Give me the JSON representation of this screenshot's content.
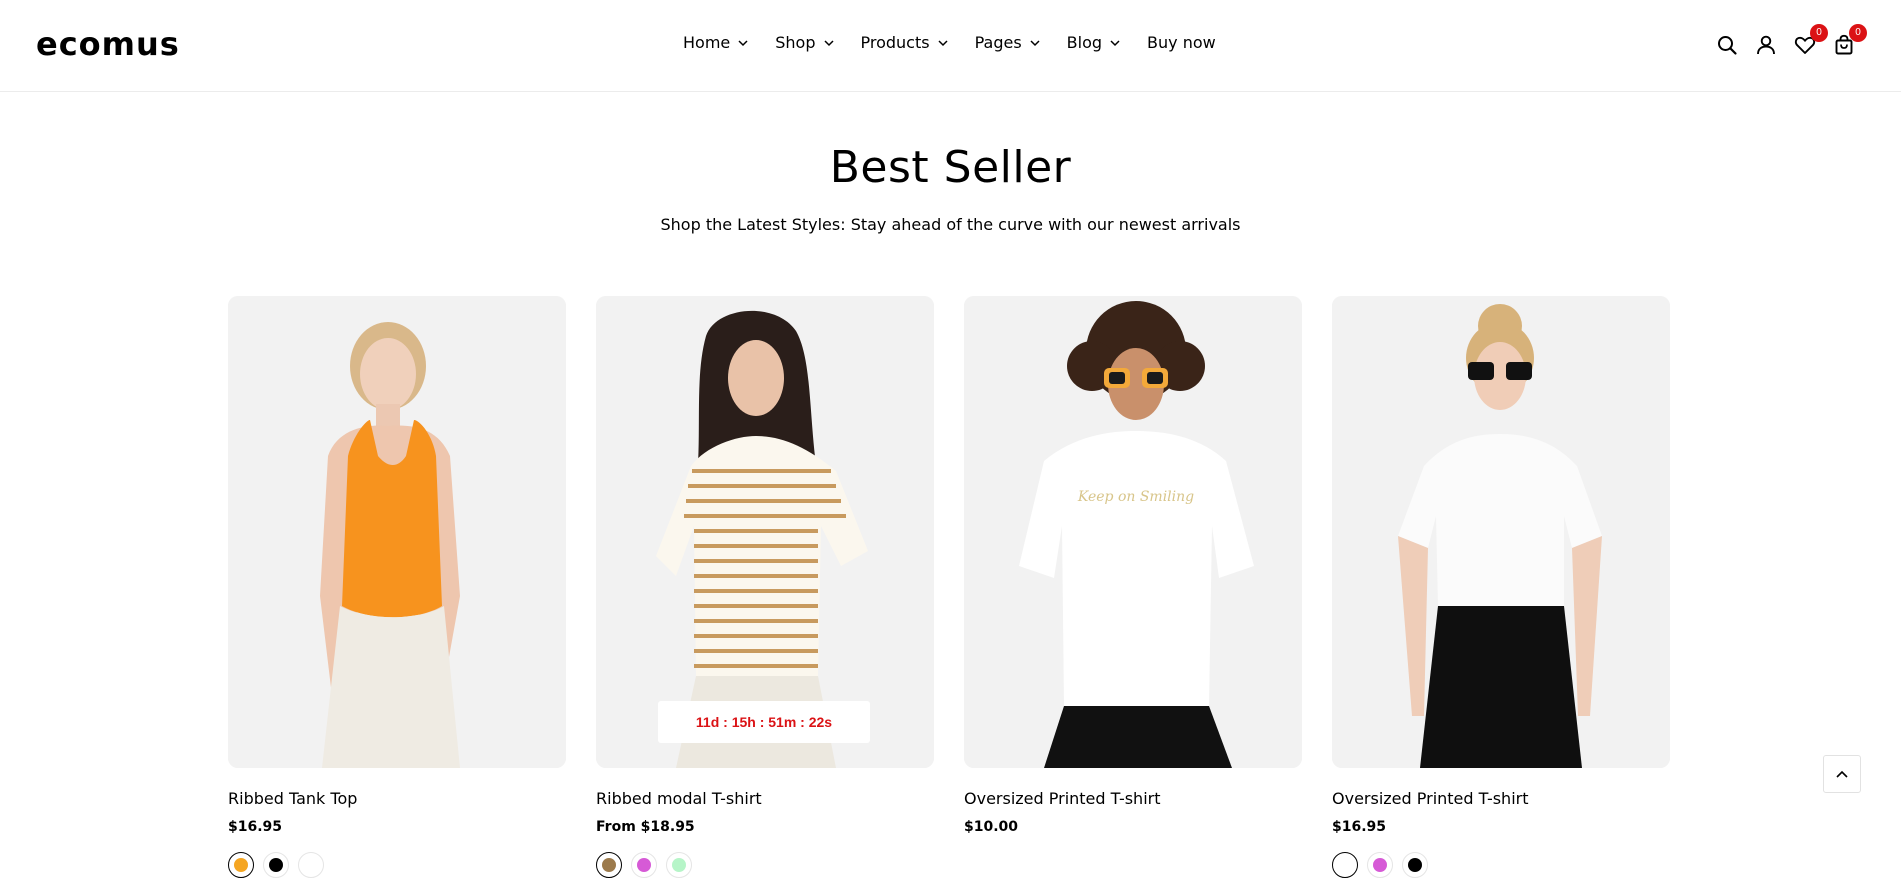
{
  "header": {
    "logo": "ecomus",
    "nav": [
      {
        "label": "Home",
        "has_dropdown": true
      },
      {
        "label": "Shop",
        "has_dropdown": true
      },
      {
        "label": "Products",
        "has_dropdown": true
      },
      {
        "label": "Pages",
        "has_dropdown": true
      },
      {
        "label": "Blog",
        "has_dropdown": true
      },
      {
        "label": "Buy now",
        "has_dropdown": false
      }
    ],
    "icons": {
      "search": "search-icon",
      "account": "user-icon",
      "wishlist": "heart-icon",
      "cart": "bag-icon"
    },
    "wishlist_count": "0",
    "cart_count": "0"
  },
  "section": {
    "title": "Best Seller",
    "subtitle": "Shop the Latest Styles: Stay ahead of the curve with our newest arrivals"
  },
  "products": [
    {
      "name": "Ribbed Tank Top",
      "price": "$16.95",
      "swatches": [
        "#f5a623",
        "#000000",
        "#ffffff"
      ],
      "active_swatch": 0,
      "countdown": ""
    },
    {
      "name": "Ribbed modal T-shirt",
      "price": "From $18.95",
      "swatches": [
        "#9c7a4b",
        "#d65ad6",
        "#b6f5c8"
      ],
      "active_swatch": 0,
      "countdown": "11d : 15h : 51m : 22s"
    },
    {
      "name": "Oversized Printed T-shirt",
      "price": "$10.00",
      "swatches": [],
      "active_swatch": -1,
      "countdown": ""
    },
    {
      "name": "Oversized Printed T-shirt",
      "price": "$16.95",
      "swatches": [
        "#ffffff",
        "#d65ad6",
        "#000000"
      ],
      "active_swatch": 0,
      "countdown": ""
    }
  ],
  "colors": {
    "accent": "#db1215",
    "card_bg": "#f2f2f2"
  },
  "back_to_top": "chevron-up-icon"
}
